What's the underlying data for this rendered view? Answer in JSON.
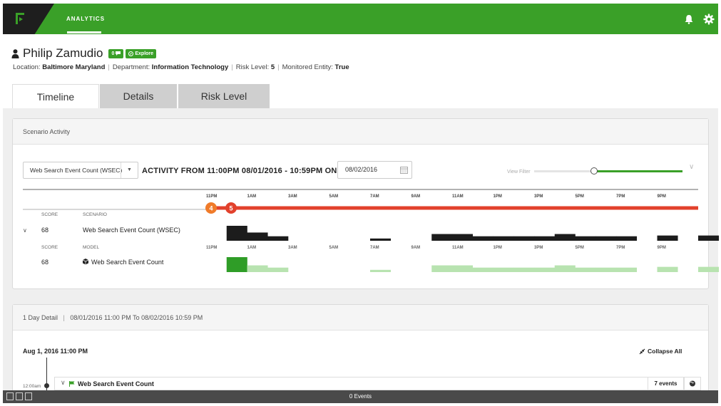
{
  "topbar": {
    "nav_analytics": "ANALYTICS",
    "accent_color": "#3aa028",
    "icons": [
      "logo-icon",
      "bell-icon",
      "gear-icon"
    ]
  },
  "user": {
    "name": "Philip Zamudio",
    "badge_count": "0",
    "badge_explore": "Explore",
    "location_label": "Location:",
    "location": "Baltimore Maryland",
    "department_label": "Department:",
    "department": "Information Technology",
    "risk_label": "Risk Level:",
    "risk": "5",
    "monitored_label": "Monitored Entity:",
    "monitored": "True"
  },
  "tabs": [
    {
      "label": "Timeline",
      "active": true
    },
    {
      "label": "Details",
      "active": false
    },
    {
      "label": "Risk Level",
      "active": false
    }
  ],
  "scenario_activity": {
    "header": "Scenario Activity",
    "select_value": "Web Search Event Count (WSEC)",
    "activity_title": "ACTIVITY FROM 11:00PM 08/01/2016 - 10:59PM ON",
    "date_value": "08/02/2016",
    "view_filter": "View Filter",
    "view_filter_level": 0.4,
    "hour_labels": [
      "11PM",
      "1AM",
      "3AM",
      "5AM",
      "7AM",
      "9AM",
      "11AM",
      "1PM",
      "3PM",
      "5PM",
      "7PM",
      "9PM"
    ],
    "risk_markers": [
      "4",
      "5"
    ],
    "scenario_row": {
      "score_header": "SCORE",
      "scenario_header": "SCENARIO",
      "score": "68",
      "name": "Web Search Event Count (WSEC)",
      "hourly_levels": [
        0,
        1.0,
        0.55,
        0.3,
        0,
        0,
        0,
        0,
        0.15,
        0,
        0,
        0.45,
        0.45,
        0.3,
        0.3,
        0.3,
        0.3,
        0.45,
        0.3,
        0.3,
        0.3,
        0,
        0.35,
        0,
        0.35
      ]
    },
    "model_row": {
      "score_header": "SCORE",
      "model_header": "MODEL",
      "score": "68",
      "name": "Web Search Event Count",
      "hourly_levels": [
        0,
        1.0,
        0.45,
        0.3,
        0,
        0,
        0,
        0,
        0.15,
        0,
        0,
        0.45,
        0.45,
        0.3,
        0.3,
        0.3,
        0.3,
        0.45,
        0.3,
        0.3,
        0.3,
        0,
        0.35,
        0,
        0.35
      ]
    }
  },
  "day_detail": {
    "header_left": "1 Day Detail",
    "header_right": "08/01/2016 11:00 PM To 08/02/2016 10:59 PM",
    "start_label": "Aug 1, 2016 11:00 PM",
    "collapse_all": "Collapse All",
    "time_label": "12:00am",
    "event_title": "Web Search Event Count",
    "event_count": "7 events"
  },
  "statusbar": {
    "text": "0 Events"
  }
}
